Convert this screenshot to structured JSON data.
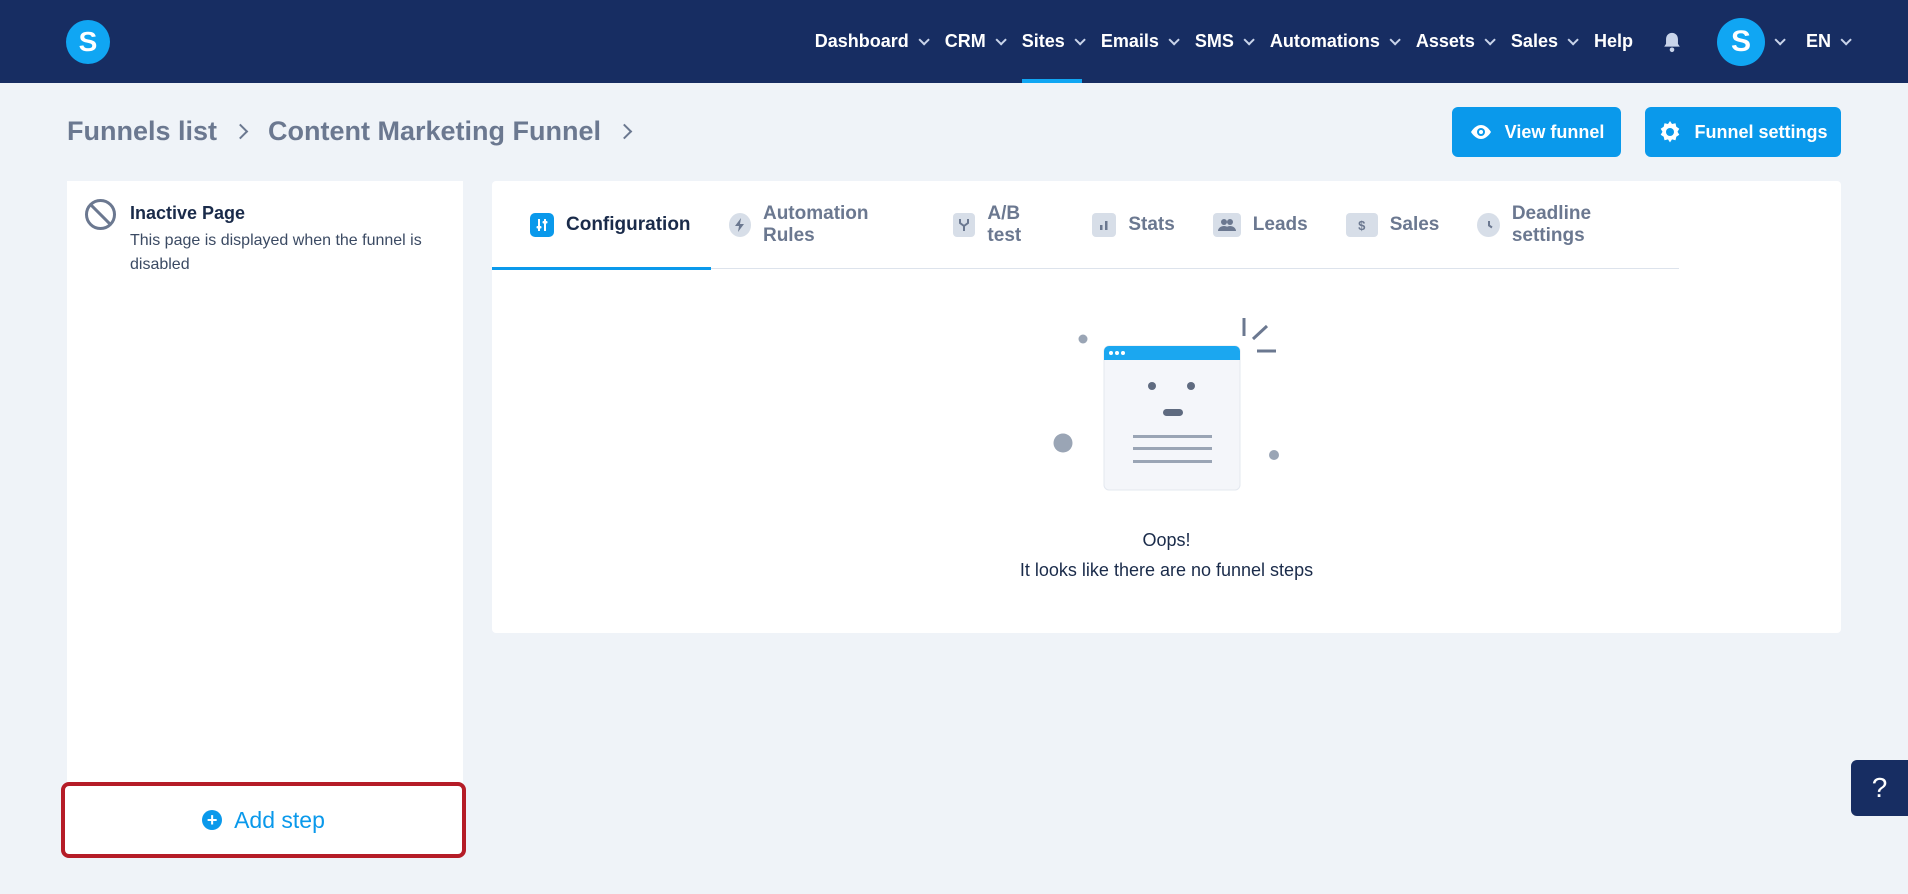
{
  "nav": {
    "items": [
      {
        "label": "Dashboard",
        "has_menu": true
      },
      {
        "label": "CRM",
        "has_menu": true
      },
      {
        "label": "Sites",
        "has_menu": true,
        "active": true
      },
      {
        "label": "Emails",
        "has_menu": true
      },
      {
        "label": "SMS",
        "has_menu": true
      },
      {
        "label": "Automations",
        "has_menu": true
      },
      {
        "label": "Assets",
        "has_menu": true
      },
      {
        "label": "Sales",
        "has_menu": true
      },
      {
        "label": "Help",
        "has_menu": false
      }
    ],
    "avatar_letter": "S",
    "language": "EN",
    "logo_letter": "S"
  },
  "breadcrumb": {
    "items": [
      "Funnels list",
      "Content Marketing Funnel"
    ]
  },
  "actions": {
    "view_funnel": "View funnel",
    "funnel_settings": "Funnel settings"
  },
  "left": {
    "inactive_title": "Inactive Page",
    "inactive_desc": "This page is displayed when the funnel is disabled",
    "add_step": "Add step"
  },
  "tabs": [
    {
      "label": "Configuration",
      "icon": "sliders-icon",
      "active": true
    },
    {
      "label": "Automation Rules",
      "icon": "bolt-icon"
    },
    {
      "label": "A/B test",
      "icon": "split-icon"
    },
    {
      "label": "Stats",
      "icon": "bar-chart-icon"
    },
    {
      "label": "Leads",
      "icon": "users-icon"
    },
    {
      "label": "Sales",
      "icon": "dollar-icon"
    },
    {
      "label": "Deadline settings",
      "icon": "clock-icon"
    }
  ],
  "empty": {
    "title": "Oops!",
    "subtitle": "It looks like there are no funnel steps"
  },
  "help_label": "?",
  "colors": {
    "nav_bg": "#172d62",
    "accent": "#0a99eb",
    "page_bg": "#eff3f8",
    "highlight_border": "#b51c27"
  }
}
